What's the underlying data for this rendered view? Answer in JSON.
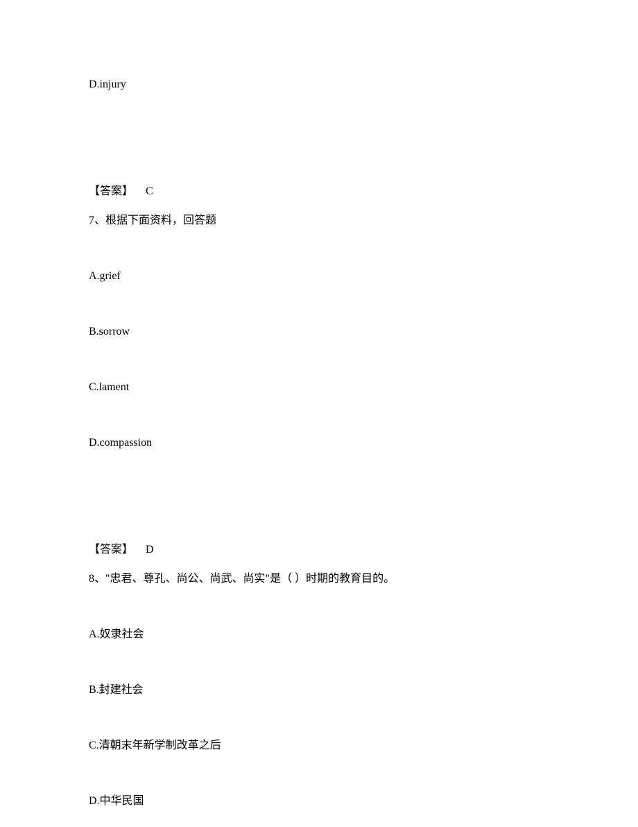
{
  "q6": {
    "option_d": "D.injury",
    "answer_label": "【答案】",
    "answer_value": "C"
  },
  "q7": {
    "question": "7、根据下面资料，回答题",
    "option_a": "A.grief",
    "option_b": "B.sorrow",
    "option_c": "C.lament",
    "option_d": "D.compassion",
    "answer_label": "【答案】",
    "answer_value": "D"
  },
  "q8": {
    "question": "8、\"忠君、尊孔、尚公、尚武、尚实\"是（ ）时期的教育目的。",
    "option_a": "A.奴隶社会",
    "option_b": "B.封建社会",
    "option_c": "C.清朝末年新学制改革之后",
    "option_d": "D.中华民国"
  }
}
